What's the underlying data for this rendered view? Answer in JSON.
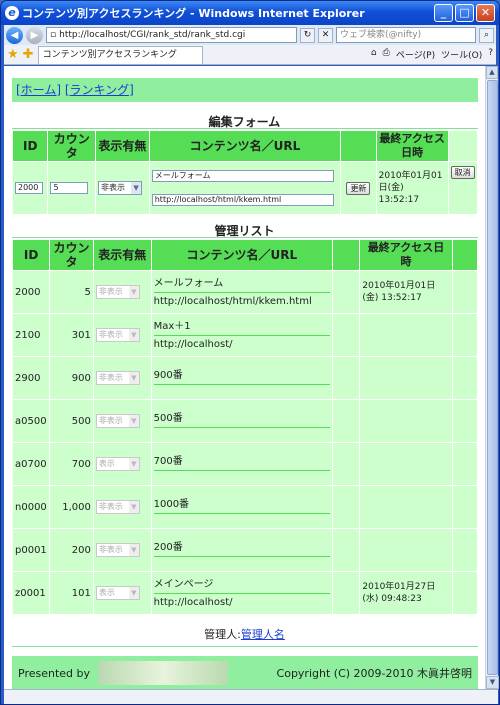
{
  "window": {
    "title": "コンテンツ別アクセスランキング - Windows Internet Explorer",
    "url": "http://localhost/CGI/rank_std/rank_std.cgi",
    "search_placeholder": "ウェブ検索(@nifty)",
    "tab_label": "コンテンツ別アクセスランキング",
    "tools": [
      "ページ(P)",
      "ツール(O)"
    ]
  },
  "nav": {
    "home": "[ホーム]",
    "ranking": "[ランキング]"
  },
  "edit_form": {
    "title": "編集フォーム",
    "headers": [
      "ID",
      "カウンタ",
      "表示有無",
      "コンテンツ名／URL",
      "",
      "最終アクセス日時",
      ""
    ],
    "id": "2000",
    "counter": "5",
    "visibility": "非表示",
    "content_name": "メールフォーム",
    "url": "http://localhost/html/kkem.html",
    "update_label": "更新",
    "last_access": "2010年01月01日(金) 13:52:17",
    "cancel_label": "取消"
  },
  "manage_list": {
    "title": "管理リスト",
    "headers": [
      "ID",
      "カウンタ",
      "表示有無",
      "コンテンツ名／URL",
      "",
      "最終アクセス日時",
      ""
    ],
    "rows": [
      {
        "id": "2000",
        "counter": "5",
        "visibility": "非表示",
        "name": "メールフォーム",
        "url": "http://localhost/html/kkem.html",
        "last_access": "2010年01月01日(金) 13:52:17"
      },
      {
        "id": "2100",
        "counter": "301",
        "visibility": "非表示",
        "name": "Max＋1",
        "url": "http://localhost/",
        "last_access": ""
      },
      {
        "id": "2900",
        "counter": "900",
        "visibility": "非表示",
        "name": "900番",
        "url": "",
        "last_access": ""
      },
      {
        "id": "a0500",
        "counter": "500",
        "visibility": "非表示",
        "name": "500番",
        "url": "",
        "last_access": ""
      },
      {
        "id": "a0700",
        "counter": "700",
        "visibility": "表示",
        "name": "700番",
        "url": "",
        "last_access": ""
      },
      {
        "id": "n0000",
        "counter": "1,000",
        "visibility": "非表示",
        "name": "1000番",
        "url": "",
        "last_access": ""
      },
      {
        "id": "p0001",
        "counter": "200",
        "visibility": "非表示",
        "name": "200番",
        "url": "",
        "last_access": ""
      },
      {
        "id": "z0001",
        "counter": "101",
        "visibility": "表示",
        "name": "メインページ",
        "url": "http://localhost/",
        "last_access": "2010年01月27日(水) 09:48:23"
      }
    ]
  },
  "manager": {
    "label": "管理人:",
    "name": "管理人名"
  },
  "footer": {
    "presented_by": "Presented by",
    "logo_text": "K.KOMATSHOUSE",
    "copyright": "Copyright (C) 2009-2010 木眞井啓明"
  }
}
